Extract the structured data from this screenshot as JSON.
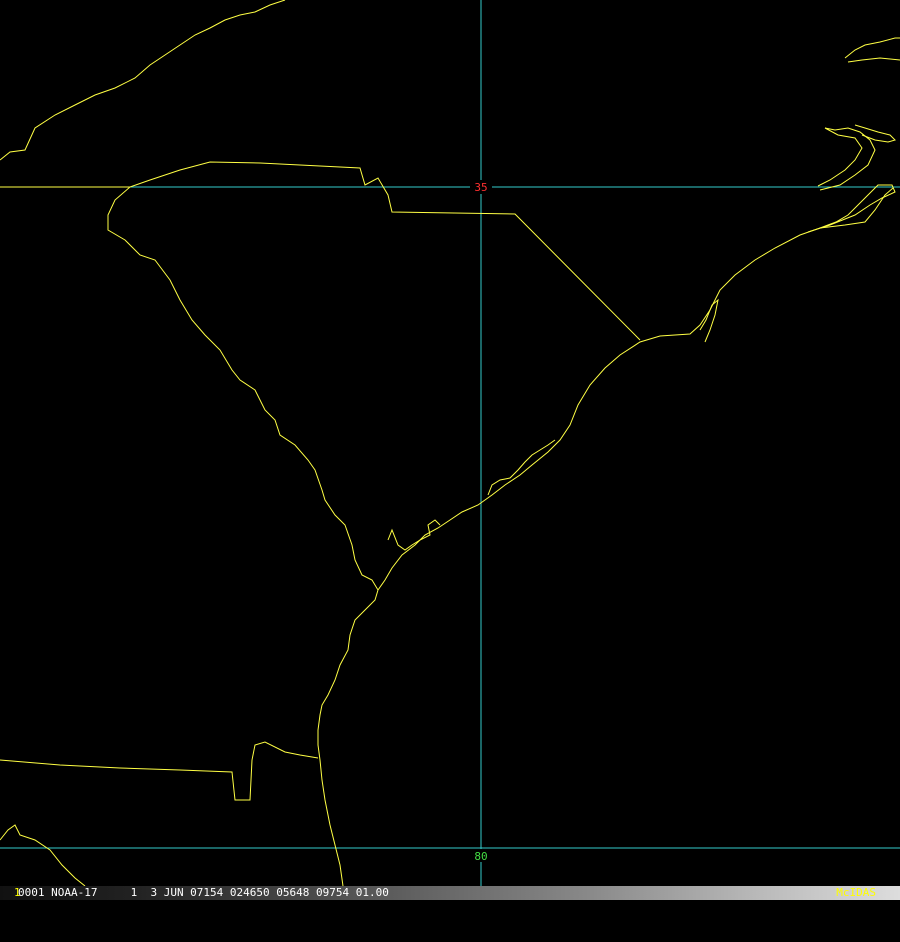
{
  "map": {
    "latitude_label": "35",
    "longitude_label": "80",
    "colors": {
      "background": "#000000",
      "coastline": "#ffff44",
      "graticule": "#33cccc",
      "lat_label": "#ff3030",
      "lon_label": "#44dd44"
    }
  },
  "status": {
    "frame_number": "1",
    "text": "0001 NOAA-17     1  3 JUN 07154 024650 05648 09754 01.00",
    "brand": "McIDAS"
  }
}
